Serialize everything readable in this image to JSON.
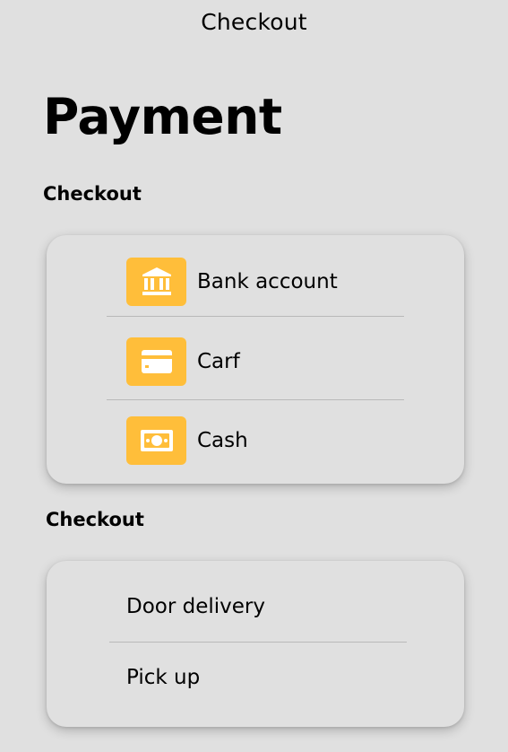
{
  "header": {
    "title": "Checkout"
  },
  "page": {
    "title": "Payment"
  },
  "payment_section": {
    "label": "Checkout",
    "methods": [
      {
        "label": "Bank account",
        "icon": "bank-icon"
      },
      {
        "label": "Carf",
        "icon": "card-icon"
      },
      {
        "label": "Cash",
        "icon": "cash-icon"
      }
    ]
  },
  "delivery_section": {
    "label": "Checkout",
    "options": [
      {
        "label": "Door delivery"
      },
      {
        "label": "Pick up"
      }
    ]
  },
  "colors": {
    "background": "#e0e0e0",
    "icon_background": "#ffbe3a",
    "icon_foreground": "#ffffff",
    "divider": "#b9b9b9"
  }
}
